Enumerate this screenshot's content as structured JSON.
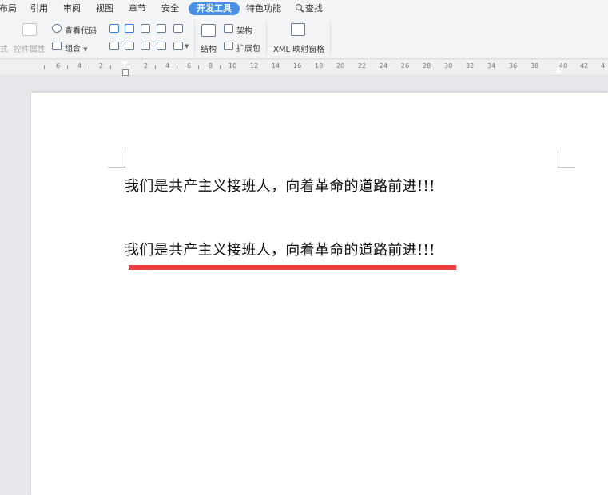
{
  "menu": {
    "tabs": [
      "布局",
      "引用",
      "审阅",
      "视图",
      "章节",
      "安全",
      "开发工具",
      "特色功能"
    ],
    "active_tab": "开发工具",
    "find_label": "查找"
  },
  "ribbon": {
    "style_label": "式",
    "control_props_label": "控件属性",
    "view_code_label": "查看代码",
    "group_label": "组合",
    "structure_label": "结构",
    "schema_label": "架构",
    "expansion_pack_label": "扩展包",
    "xml_mapping_label": "XML 映射窗格"
  },
  "ruler": {
    "numbers": [
      "6",
      "4",
      "2",
      "2",
      "4",
      "6",
      "8",
      "10",
      "12",
      "14",
      "16",
      "18",
      "20",
      "22",
      "24",
      "26",
      "28",
      "30",
      "32",
      "34",
      "36",
      "38",
      "40",
      "42",
      "4"
    ]
  },
  "document": {
    "paragraph1": "我们是共产主义接班人，向着革命的道路前进!!!",
    "paragraph2": "我们是共产主义接班人，向着革命的道路前进!!!",
    "underline_color": "#e8403f"
  }
}
